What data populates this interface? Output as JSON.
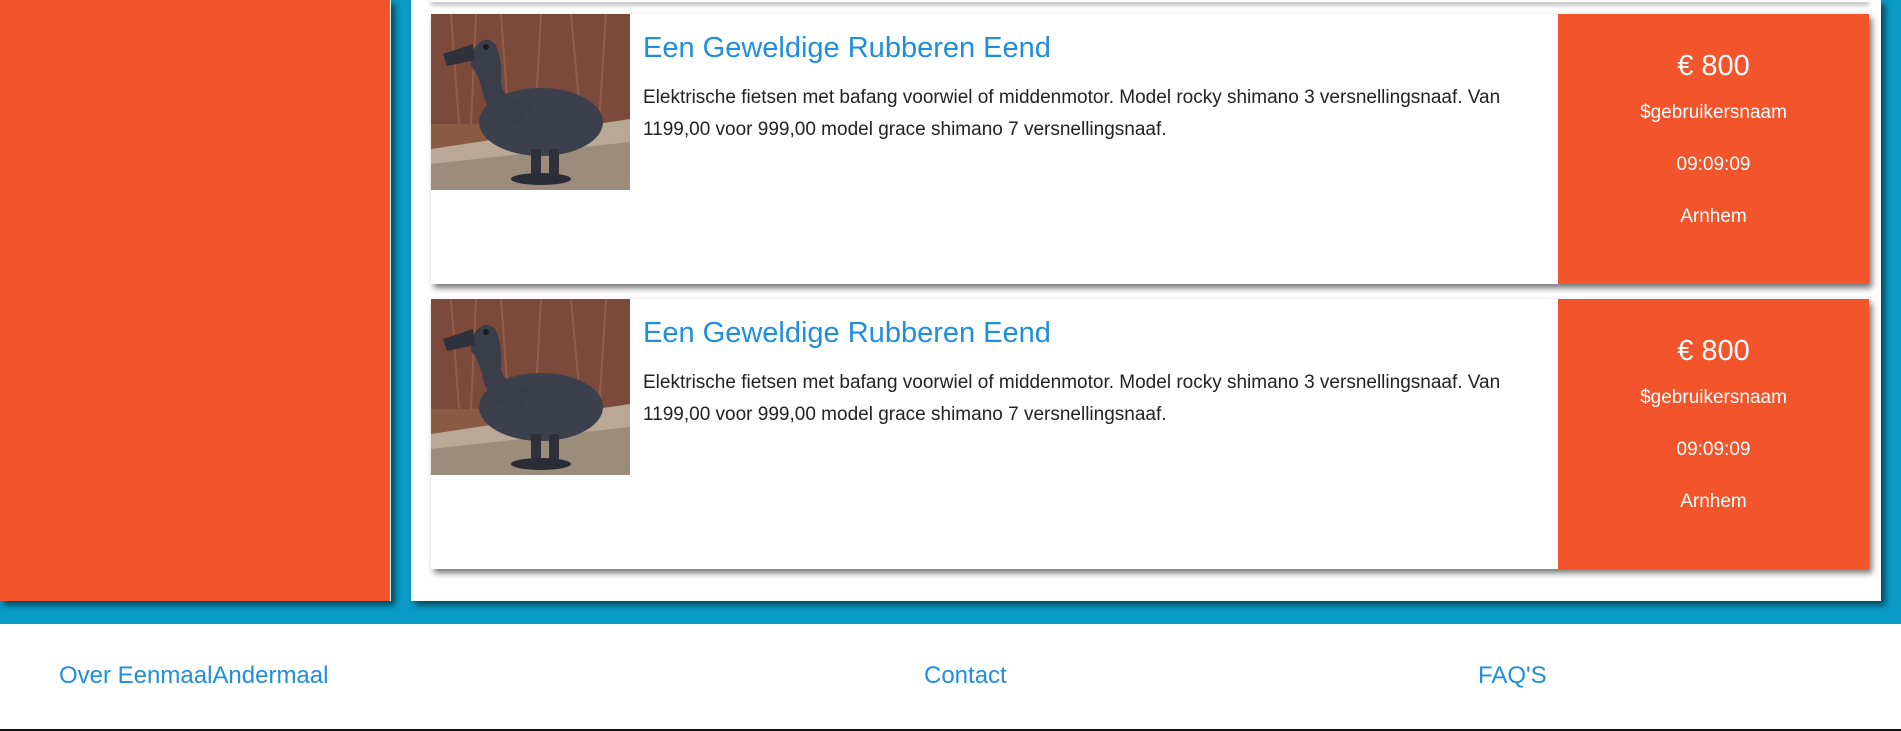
{
  "listings": [
    {
      "title": "Een Geweldige Rubberen Eend",
      "description": "Elektrische fietsen met bafang voorwiel of middenmotor. Model rocky shimano 3 versnellingsnaaf. Van 1199,00 voor 999,00 model grace shimano 7 versnellingsnaaf.",
      "price": "€ 800",
      "username": "$gebruikersnaam",
      "time": "09:09:09",
      "city": "Arnhem",
      "image_icon": "duck-statue-photo"
    },
    {
      "title": "Een Geweldige Rubberen Eend",
      "description": "Elektrische fietsen met bafang voorwiel of middenmotor. Model rocky shimano 3 versnellingsnaaf. Van 1199,00 voor 999,00 model grace shimano 7 versnellingsnaaf.",
      "price": "€ 800",
      "username": "$gebruikersnaam",
      "time": "09:09:09",
      "city": "Arnhem",
      "image_icon": "duck-statue-photo"
    }
  ],
  "footer": {
    "links": [
      "Over EenmaalAndermaal",
      "Contact",
      "FAQ'S"
    ]
  },
  "colors": {
    "accent_orange": "#f2552c",
    "background_blue": "#0a9ac6",
    "link_blue": "#1f8edc"
  }
}
